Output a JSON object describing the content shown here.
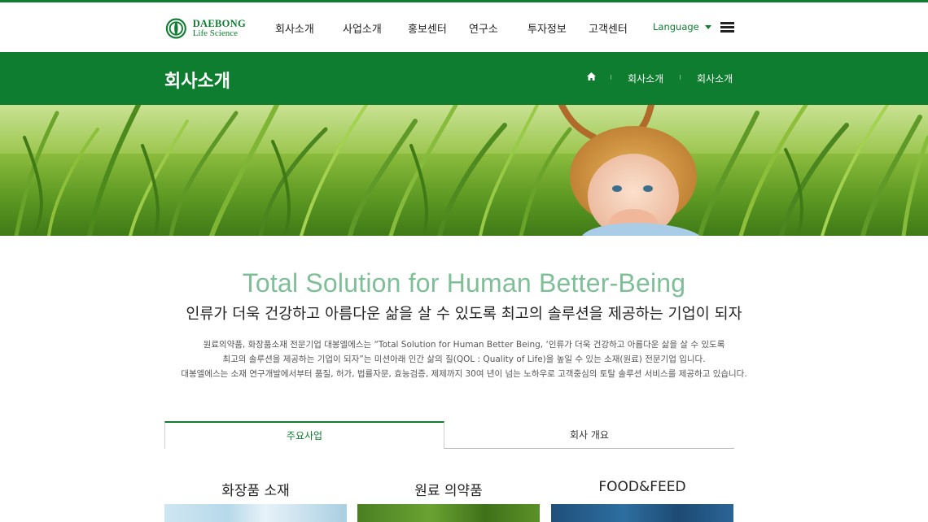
{
  "header": {
    "logo": {
      "line1": "DAEBONG",
      "line2": "Life Science"
    },
    "nav": [
      "회사소개",
      "사업소개",
      "홍보센터",
      "연구소",
      "투자정보",
      "고객센터"
    ],
    "language_label": "Language"
  },
  "band": {
    "title": "회사소개",
    "breadcrumb": [
      "회사소개",
      "회사소개"
    ]
  },
  "intro": {
    "tagline": "Total Solution for Human Better-Being",
    "subhead": "인류가 더욱 건강하고 아름다운 삶을 살 수 있도록 최고의 솔루션을 제공하는 기업이 되자",
    "paragraph": [
      "원료의약품, 화장품소재 전문기업 대봉엘에스는 “Total Solution for Human Better Being, ‘인류가 더욱 건강하고 아름다운 삶을 살 수 있도록",
      "최고의 솔루션을 제공하는 기업이 되자”는 미션아래 인간 삶의 질(QOL : Quality of Life)을 높일 수 있는 소재(원료) 전문기업 입니다.",
      "대봉엘에스는 소재 연구개발에서부터 품질, 허가, 법률자문, 효능검증, 제제까지 30여 년이 넘는 노하우로 고객중심의 토탈 솔루션 서비스를 제공하고 있습니다."
    ]
  },
  "tabs": {
    "active": "주요사업",
    "inactive": "회사 개요"
  },
  "cards": [
    {
      "title": "화장품 소재"
    },
    {
      "title": "원료 의약품"
    },
    {
      "title": "FOOD&FEED"
    }
  ],
  "colors": {
    "brand_green": "#0e7d2f",
    "tagline_green": "#7fbf97"
  }
}
